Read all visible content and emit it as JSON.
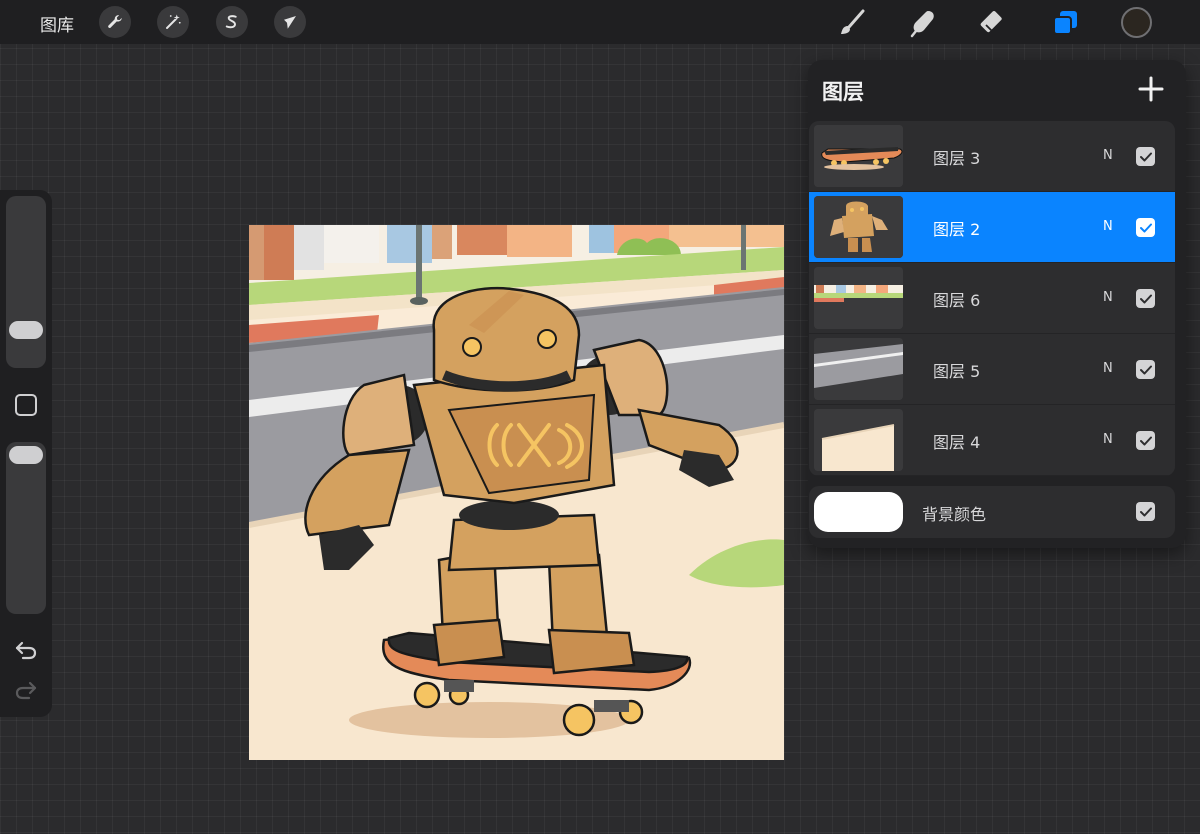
{
  "topbar": {
    "gallery_label": "图库",
    "left_tools": [
      {
        "name": "actions",
        "icon": "wrench-icon"
      },
      {
        "name": "adjustments",
        "icon": "magic-wand-icon"
      },
      {
        "name": "selection",
        "icon": "selection-s-icon"
      },
      {
        "name": "transform",
        "icon": "arrow-cursor-icon"
      }
    ],
    "right_tools": [
      {
        "name": "brush",
        "icon": "brush-icon"
      },
      {
        "name": "smudge",
        "icon": "smudge-finger-icon"
      },
      {
        "name": "eraser",
        "icon": "eraser-icon"
      },
      {
        "name": "layers",
        "icon": "layers-icon",
        "active": true
      }
    ],
    "current_color": "#2b2620",
    "accent_color": "#0a84ff"
  },
  "sidebar": {
    "brush_size_level": 0.74,
    "opacity_level": 0.93
  },
  "layers_panel": {
    "title": "图层",
    "add_symbol": "+",
    "layers": [
      {
        "name": "图层 3",
        "blend": "N",
        "visible": true,
        "selected": false,
        "thumb": "skateboard"
      },
      {
        "name": "图层 2",
        "blend": "N",
        "visible": true,
        "selected": true,
        "thumb": "robot"
      },
      {
        "name": "图层 6",
        "blend": "N",
        "visible": true,
        "selected": false,
        "thumb": "street-background"
      },
      {
        "name": "图层 5",
        "blend": "N",
        "visible": true,
        "selected": false,
        "thumb": "road"
      },
      {
        "name": "图层 4",
        "blend": "N",
        "visible": true,
        "selected": false,
        "thumb": "sidewalk"
      }
    ],
    "background": {
      "name": "背景颜色",
      "color": "#ffffff",
      "visible": true
    }
  }
}
